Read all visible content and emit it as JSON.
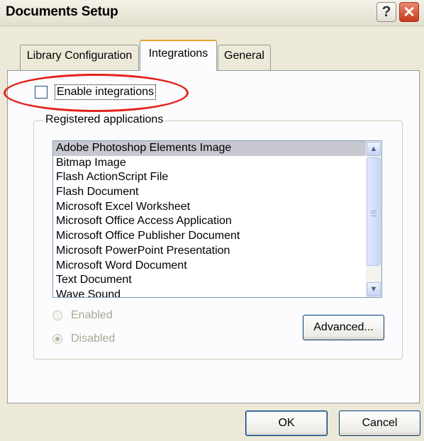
{
  "window": {
    "title": "Documents Setup",
    "help_glyph": "?",
    "close_glyph": "✕"
  },
  "tabs": [
    {
      "label": "Library Configuration",
      "active": false
    },
    {
      "label": "Integrations",
      "active": true
    },
    {
      "label": "General",
      "active": false
    }
  ],
  "integrations": {
    "enable_label": "Enable integrations",
    "enable_checked": false,
    "group_title": "Registered applications",
    "applications": [
      "Adobe Photoshop Elements Image",
      "Bitmap Image",
      "Flash ActionScript File",
      "Flash Document",
      "Microsoft Excel Worksheet",
      "Microsoft Office Access Application",
      "Microsoft Office Publisher Document",
      "Microsoft PowerPoint Presentation",
      "Microsoft Word Document",
      "Text Document",
      "Wave Sound"
    ],
    "selected_application": "Adobe Photoshop Elements Image",
    "radio_enabled_label": "Enabled",
    "radio_disabled_label": "Disabled",
    "selected_radio": "Disabled",
    "advanced_label": "Advanced..."
  },
  "footer": {
    "ok_label": "OK",
    "cancel_label": "Cancel"
  },
  "colors": {
    "annotation": "#e2231a",
    "close_button": "#c6391a",
    "active_tab_accent": "#e6a32e"
  }
}
